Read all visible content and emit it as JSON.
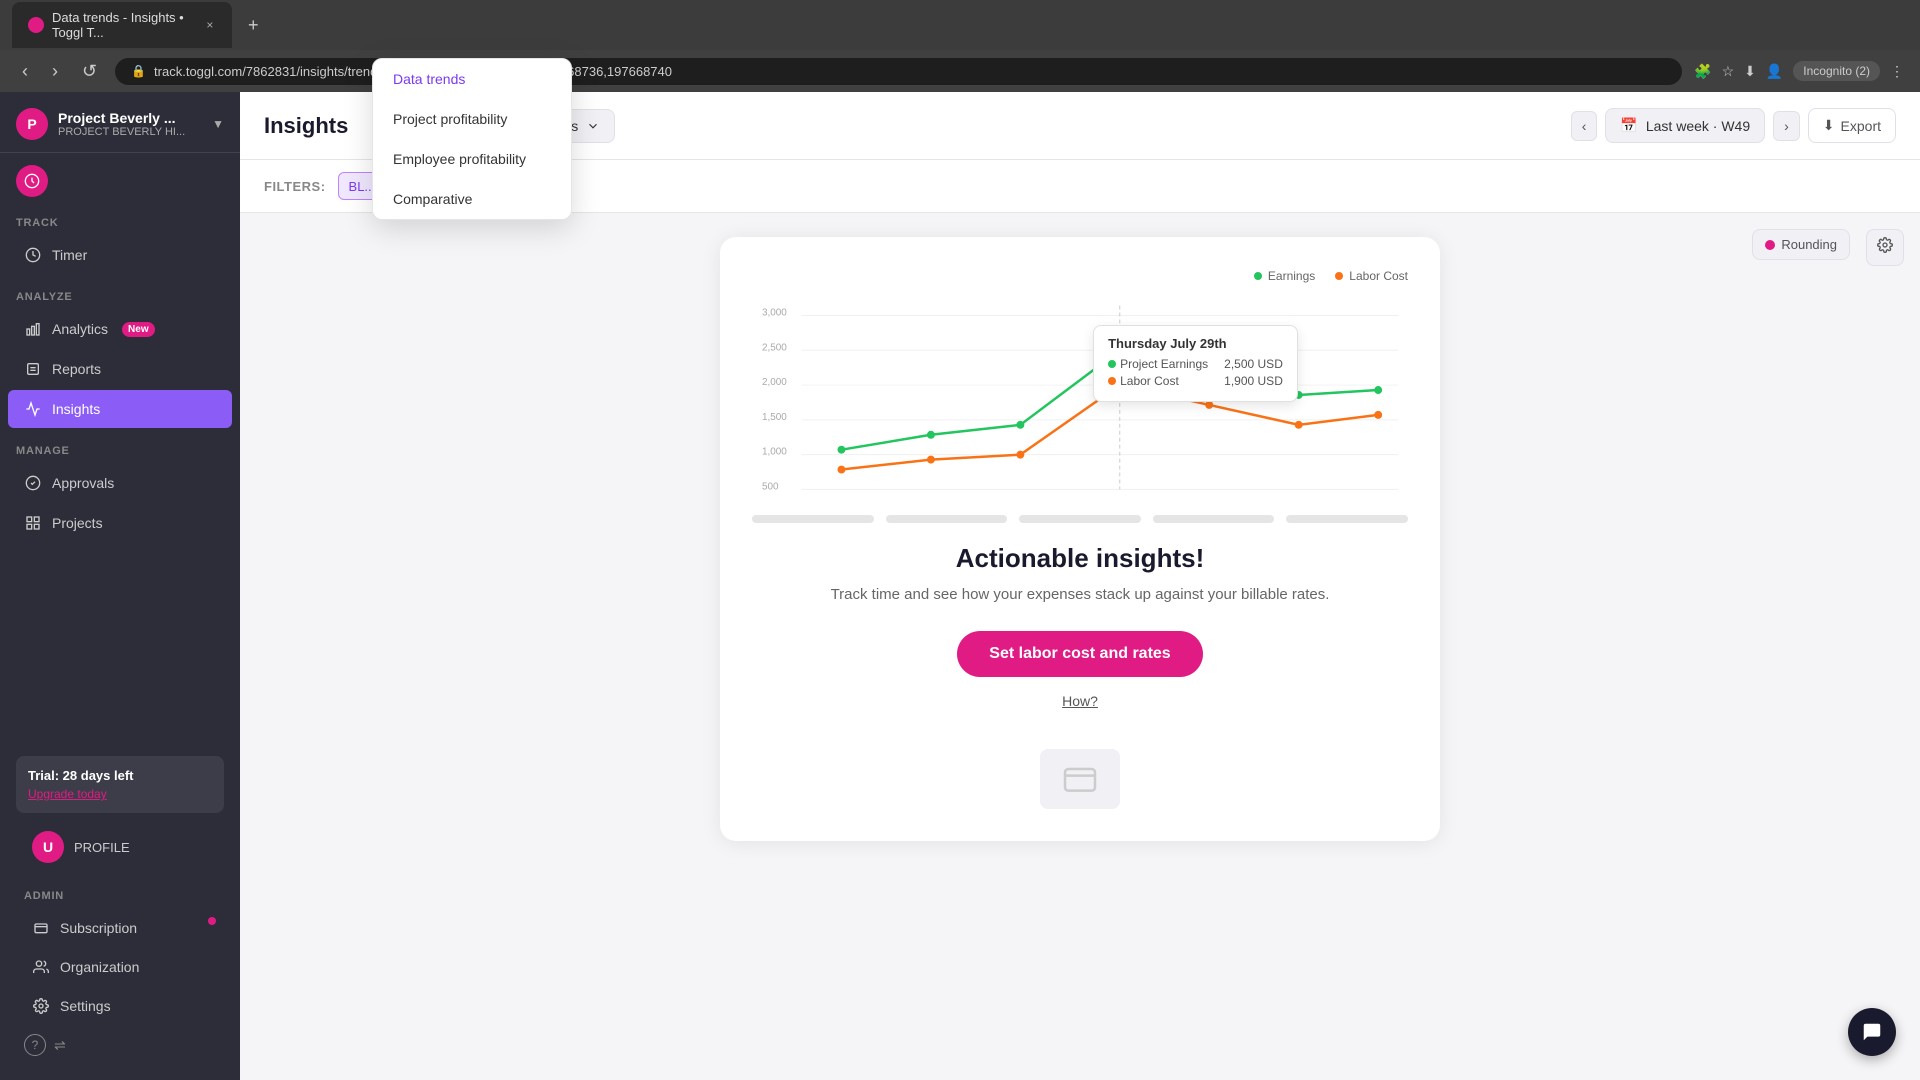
{
  "browser": {
    "tab_title": "Data trends - Insights • Toggl T...",
    "url": "track.toggl.com/7862831/insights/trends/period/prevWeek/projects/197668736,197668740",
    "incognito_label": "Incognito (2)"
  },
  "sidebar": {
    "workspace_name": "Project Beverly ...",
    "workspace_sub": "PROJECT BEVERLY HI...",
    "workspace_icon": "P",
    "sections": {
      "track_label": "TRACK",
      "analyze_label": "ANALYZE",
      "manage_label": "MANAGE",
      "admin_label": "ADMIN"
    },
    "items": {
      "timer": "Timer",
      "analytics": "Analytics",
      "analytics_badge": "New",
      "reports": "Reports",
      "insights": "Insights",
      "approvals": "Approvals",
      "projects": "Projects",
      "subscription": "Subscription",
      "organization": "Organization",
      "settings": "Settings"
    },
    "trial": {
      "title": "Trial: 28 days left",
      "upgrade_link": "Upgrade today"
    },
    "profile_label": "PROFILE"
  },
  "topbar": {
    "page_title": "Insights",
    "dropdown_label": "Data trends",
    "projects_label": "Projects",
    "week_label": "Last week · W49",
    "export_label": "Export"
  },
  "filters": {
    "label": "FILTERS:",
    "chip_label": "BL...",
    "close_label": "×"
  },
  "dropdown_menu": {
    "items": [
      {
        "label": "Data trends",
        "active": true
      },
      {
        "label": "Project profitability",
        "active": false
      },
      {
        "label": "Employee profitability",
        "active": false
      },
      {
        "label": "Comparative",
        "active": false
      }
    ]
  },
  "rounding": {
    "label": "Rounding"
  },
  "chart": {
    "tooltip": {
      "title": "Thursday July 29th",
      "earnings_label": "Project Earnings",
      "earnings_value": "2,500 USD",
      "labor_label": "Labor Cost",
      "labor_value": "1,900 USD"
    },
    "legend": {
      "earnings_label": "Earnings",
      "labor_label": "Labor Cost"
    }
  },
  "overlay": {
    "title": "Actionable insights!",
    "description": "Track time and see how your expenses stack up against your billable rates.",
    "cta_label": "Set labor cost and rates",
    "how_label": "How?"
  },
  "chat_btn": "💬"
}
